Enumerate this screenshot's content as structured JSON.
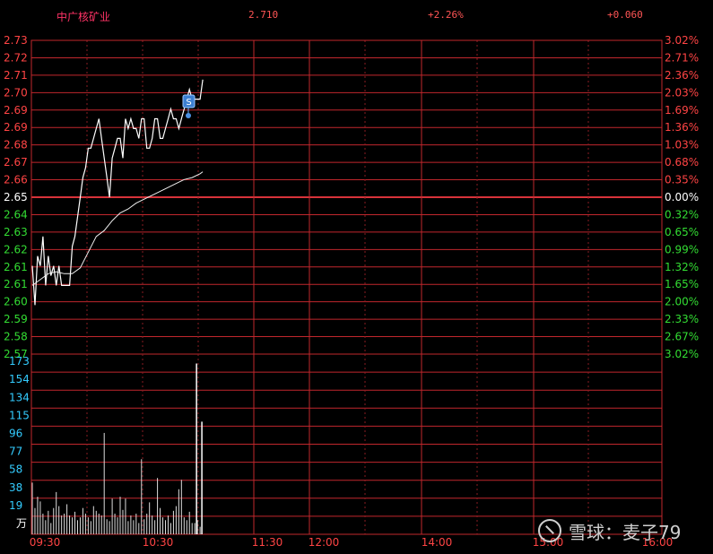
{
  "header": {
    "stock_name": "中广核矿业",
    "price": "2.710",
    "change_percent": "+2.26%",
    "change_value": "+0.060"
  },
  "price_axis_left": [
    "2.73",
    "2.72",
    "2.71",
    "2.70",
    "2.69",
    "2.69",
    "2.68",
    "2.67",
    "2.66",
    "2.65",
    "2.64",
    "2.63",
    "2.62",
    "2.61",
    "2.61",
    "2.60",
    "2.59",
    "2.58",
    "2.57"
  ],
  "price_axis_right": [
    "3.02%",
    "2.71%",
    "2.36%",
    "2.03%",
    "1.69%",
    "1.36%",
    "1.03%",
    "0.68%",
    "0.35%",
    "0.00%",
    "0.32%",
    "0.65%",
    "0.99%",
    "1.32%",
    "1.65%",
    "2.00%",
    "2.33%",
    "2.67%",
    "3.02%"
  ],
  "volume_axis": [
    "173",
    "154",
    "134",
    "115",
    "96",
    "77",
    "58",
    "38",
    "19",
    "万"
  ],
  "time_axis": [
    "09:30",
    "10:30",
    "11:30",
    "12:00",
    "14:00",
    "15:00",
    "16:00"
  ],
  "marker": {
    "label": "S"
  },
  "watermark": {
    "brand": "雪球",
    "separator": "：",
    "author": "麦子79"
  },
  "chart_data": {
    "type": "line",
    "prev_close": 2.65,
    "ylim_price": [
      2.57,
      2.73
    ],
    "ylim_volume": [
      0,
      192
    ],
    "series": [
      {
        "name": "",
        "kind": "price",
        "minutes": [
          0,
          1,
          2,
          3,
          4,
          5,
          6,
          7,
          8,
          9,
          10,
          11,
          12,
          13,
          14,
          15,
          16,
          17,
          18,
          19,
          20,
          21,
          22,
          23,
          24,
          25,
          26,
          27,
          28,
          29,
          30,
          31,
          32,
          33,
          34,
          35,
          36,
          37,
          38,
          39,
          40,
          41,
          42,
          43,
          44,
          45,
          46,
          47,
          48,
          49,
          50,
          51,
          52,
          53,
          54,
          55,
          56,
          57,
          58,
          59,
          60,
          61,
          62,
          63,
          64
        ],
        "values": [
          2.615,
          2.595,
          2.62,
          2.615,
          2.63,
          2.605,
          2.62,
          2.61,
          2.615,
          2.605,
          2.615,
          2.605,
          2.605,
          2.605,
          2.605,
          2.625,
          2.63,
          2.64,
          2.65,
          2.66,
          2.665,
          2.675,
          2.675,
          2.68,
          2.685,
          2.69,
          2.68,
          2.67,
          2.66,
          2.65,
          2.67,
          2.675,
          2.68,
          2.68,
          2.67,
          2.69,
          2.685,
          2.69,
          2.685,
          2.685,
          2.68,
          2.69,
          2.69,
          2.675,
          2.675,
          2.68,
          2.69,
          2.69,
          2.68,
          2.68,
          2.685,
          2.69,
          2.695,
          2.69,
          2.69,
          2.685,
          2.69,
          2.695,
          2.7,
          2.705,
          2.7,
          2.7,
          2.7,
          2.7,
          2.71
        ]
      },
      {
        "name": "",
        "kind": "average",
        "minutes": [
          0,
          3,
          6,
          9,
          12,
          15,
          18,
          21,
          24,
          27,
          30,
          33,
          36,
          39,
          42,
          45,
          48,
          51,
          54,
          57,
          60,
          63,
          64
        ],
        "values": [
          2.605,
          2.608,
          2.611,
          2.612,
          2.611,
          2.611,
          2.614,
          2.622,
          2.63,
          2.633,
          2.638,
          2.642,
          2.644,
          2.647,
          2.649,
          2.651,
          2.653,
          2.655,
          2.657,
          2.659,
          2.66,
          2.662,
          2.663
        ]
      },
      {
        "name": "",
        "kind": "volume",
        "minutes": [
          0,
          1,
          2,
          3,
          4,
          5,
          6,
          7,
          8,
          9,
          10,
          11,
          12,
          13,
          14,
          15,
          16,
          17,
          18,
          19,
          20,
          21,
          22,
          23,
          24,
          25,
          26,
          27,
          28,
          29,
          30,
          31,
          32,
          33,
          34,
          35,
          36,
          37,
          38,
          39,
          40,
          41,
          42,
          43,
          44,
          45,
          46,
          47,
          48,
          49,
          50,
          51,
          52,
          53,
          54,
          55,
          56,
          57,
          58,
          59,
          60,
          61,
          62,
          63,
          64
        ],
        "values": [
          55,
          28,
          40,
          35,
          22,
          15,
          25,
          12,
          28,
          45,
          30,
          20,
          22,
          32,
          20,
          18,
          24,
          15,
          18,
          28,
          22,
          18,
          14,
          30,
          25,
          22,
          20,
          108,
          16,
          14,
          38,
          22,
          18,
          40,
          26,
          38,
          14,
          20,
          15,
          22,
          12,
          80,
          16,
          22,
          34,
          20,
          15,
          60,
          28,
          18,
          15,
          20,
          12,
          25,
          30,
          48,
          58,
          18,
          15,
          24,
          12,
          12,
          15,
          8,
          0
        ]
      }
    ],
    "spikes": {
      "minutes": [
        62,
        64
      ],
      "values": [
        182,
        120
      ]
    }
  }
}
